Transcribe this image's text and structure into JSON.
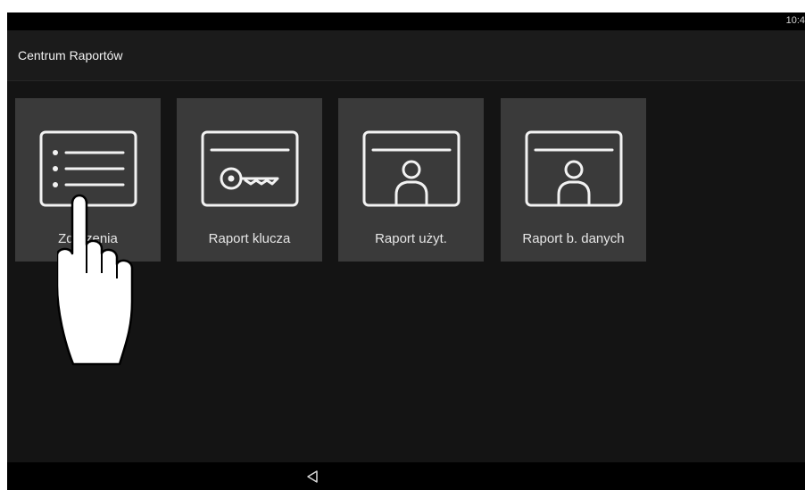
{
  "status_bar": {
    "time": "10:4"
  },
  "app_bar": {
    "title": "Centrum Raportów"
  },
  "tiles": [
    {
      "label": "Zdarzenia",
      "icon": "event-list-icon"
    },
    {
      "label": "Raport klucza",
      "icon": "key-card-icon"
    },
    {
      "label": "Raport użyt.",
      "icon": "user-card-icon"
    },
    {
      "label": "Raport b. danych",
      "icon": "user-card-icon"
    }
  ],
  "nav_bar": {
    "back_icon": "back-triangle-icon"
  },
  "overlay": {
    "icon": "pointing-hand-icon"
  },
  "colors": {
    "background": "#141414",
    "tile": "#3a3a3a",
    "text": "#e6e6e6"
  }
}
